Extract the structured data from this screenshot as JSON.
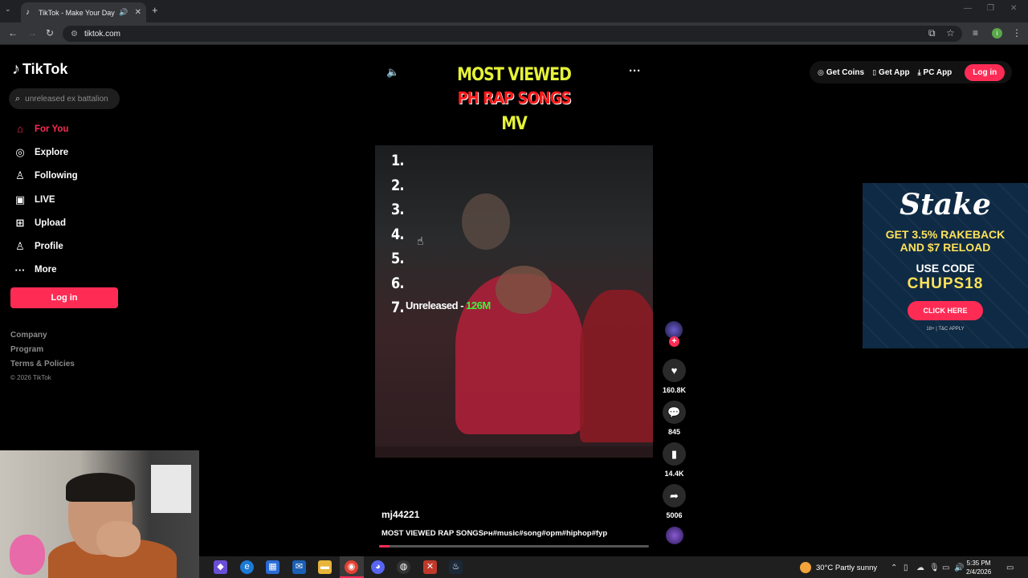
{
  "browser": {
    "tab_title": "TikTok - Make Your Day",
    "url": "tiktok.com"
  },
  "sidebar": {
    "logo": "TikTok",
    "search_placeholder": "unreleased ex battalion",
    "items": [
      {
        "label": "For You",
        "icon": "home-icon",
        "active": true
      },
      {
        "label": "Explore",
        "icon": "compass-icon"
      },
      {
        "label": "Following",
        "icon": "following-icon"
      },
      {
        "label": "LIVE",
        "icon": "live-icon"
      },
      {
        "label": "Upload",
        "icon": "upload-icon"
      },
      {
        "label": "Profile",
        "icon": "profile-icon"
      },
      {
        "label": "More",
        "icon": "more-icon"
      }
    ],
    "login_label": "Log in",
    "footer": [
      "Company",
      "Program",
      "Terms & Policies"
    ],
    "copyright": "© 2026 TikTok"
  },
  "topbar": {
    "get_coins": "Get Coins",
    "get_app": "Get App",
    "pc_app": "PC App",
    "login": "Log in"
  },
  "video": {
    "title_line1": "MOST VIEWED",
    "title_line2": "PH RAP SONGS",
    "title_line3": "MV",
    "ranks": [
      "1.",
      "2.",
      "3.",
      "4.",
      "5.",
      "6.",
      "7."
    ],
    "rank7_text": "Unreleased - ",
    "rank7_views": "126M",
    "author": "mj44221",
    "description": "MOST VIEWED RAP SONGSᴘʜ#music#song#opm#hiphop#fyp",
    "progress": 0.04
  },
  "actions": {
    "likes": "160.8K",
    "comments": "845",
    "saves": "14.4K",
    "shares": "5006"
  },
  "ad": {
    "brand": "Stake",
    "line1a": "GET 3.5% RAKEBACK",
    "line1b": "AND $7 RELOAD",
    "line2": "USE CODE",
    "code": "CHUPS18",
    "button": "CLICK HERE",
    "fine": "18+ | T&C APPLY"
  },
  "taskbar": {
    "weather": "30°C  Partly sunny",
    "time": "5:35 PM",
    "date": "2/4/2026"
  },
  "colors": {
    "accent": "#fe2c55",
    "title_yellow": "#e5f237",
    "title_red": "#ff1a1a",
    "views_green": "#3cf53c"
  }
}
